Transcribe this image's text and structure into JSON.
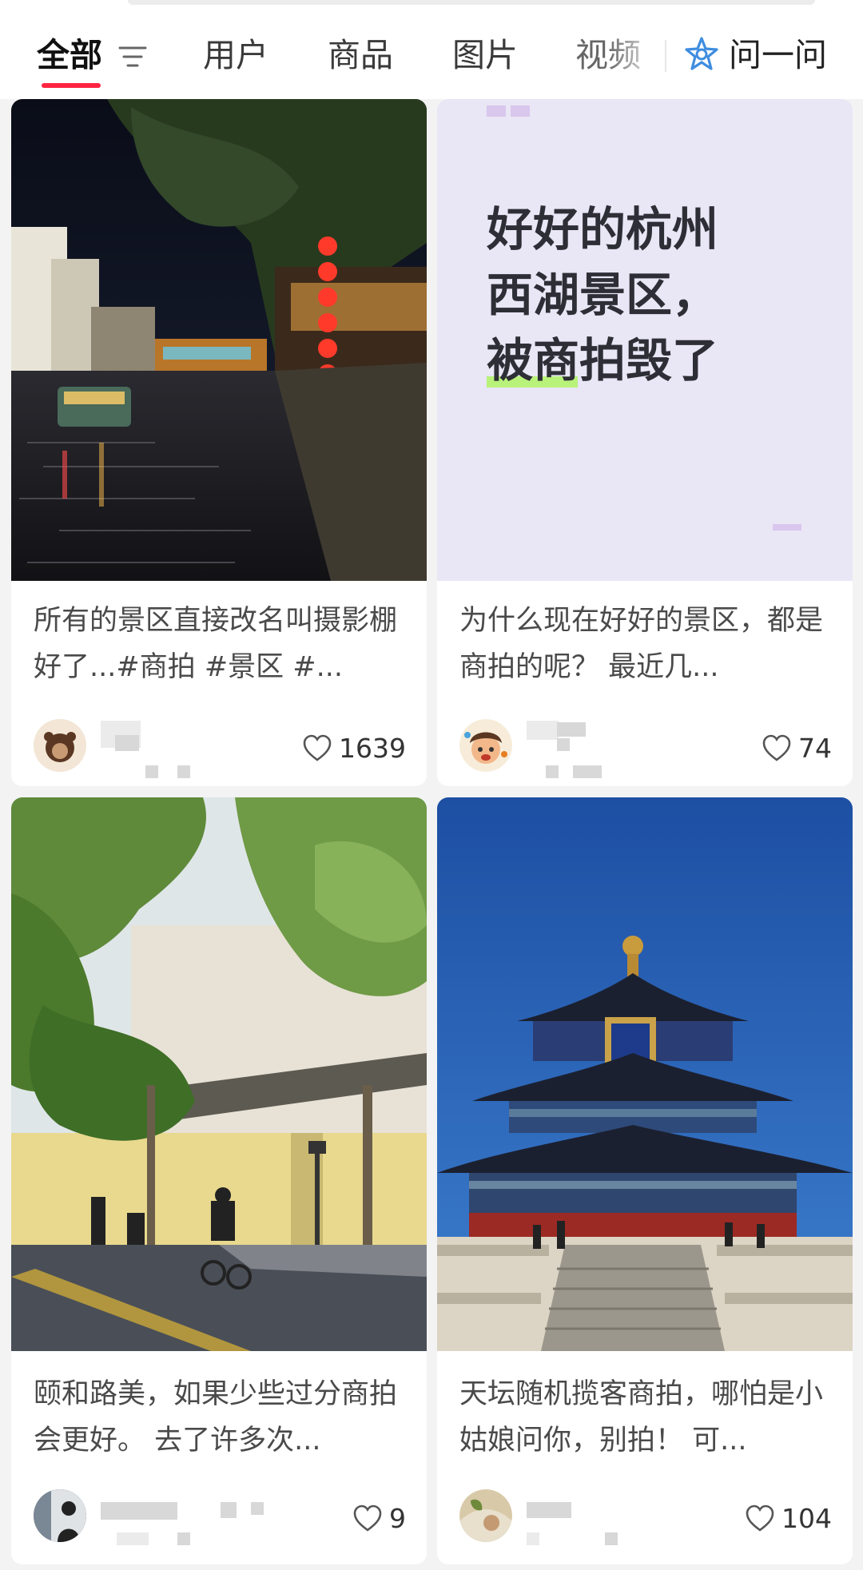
{
  "tabs": [
    {
      "label": "全部",
      "active": true
    },
    {
      "label": "用户"
    },
    {
      "label": "商品"
    },
    {
      "label": "图片"
    },
    {
      "label": "视频"
    }
  ],
  "ask": {
    "label": "问一问",
    "icon": "ai-star-icon"
  },
  "colors": {
    "accent": "#ff2442",
    "ask_icon": "#3f8de0"
  },
  "cards": [
    {
      "title": "所有的景区直接改名叫摄影棚好了...#商拍 #景区 #...",
      "likes": "1639",
      "image": "night-canal-lanterns"
    },
    {
      "title": "为什么现在好好的景区，都是商拍的呢？ 最近几...",
      "likes": "74",
      "image": "text-cover",
      "cover_lines": [
        "好好的杭州",
        "西湖景区，",
        "被商拍毁了"
      ]
    },
    {
      "title": "颐和路美，如果少些过分商拍会更好。 去了许多次...",
      "likes": "9",
      "image": "tree-lined-street"
    },
    {
      "title": "天坛随机揽客商拍，哪怕是小姑娘问你，别拍！ 可...",
      "likes": "104",
      "image": "temple-of-heaven"
    }
  ]
}
